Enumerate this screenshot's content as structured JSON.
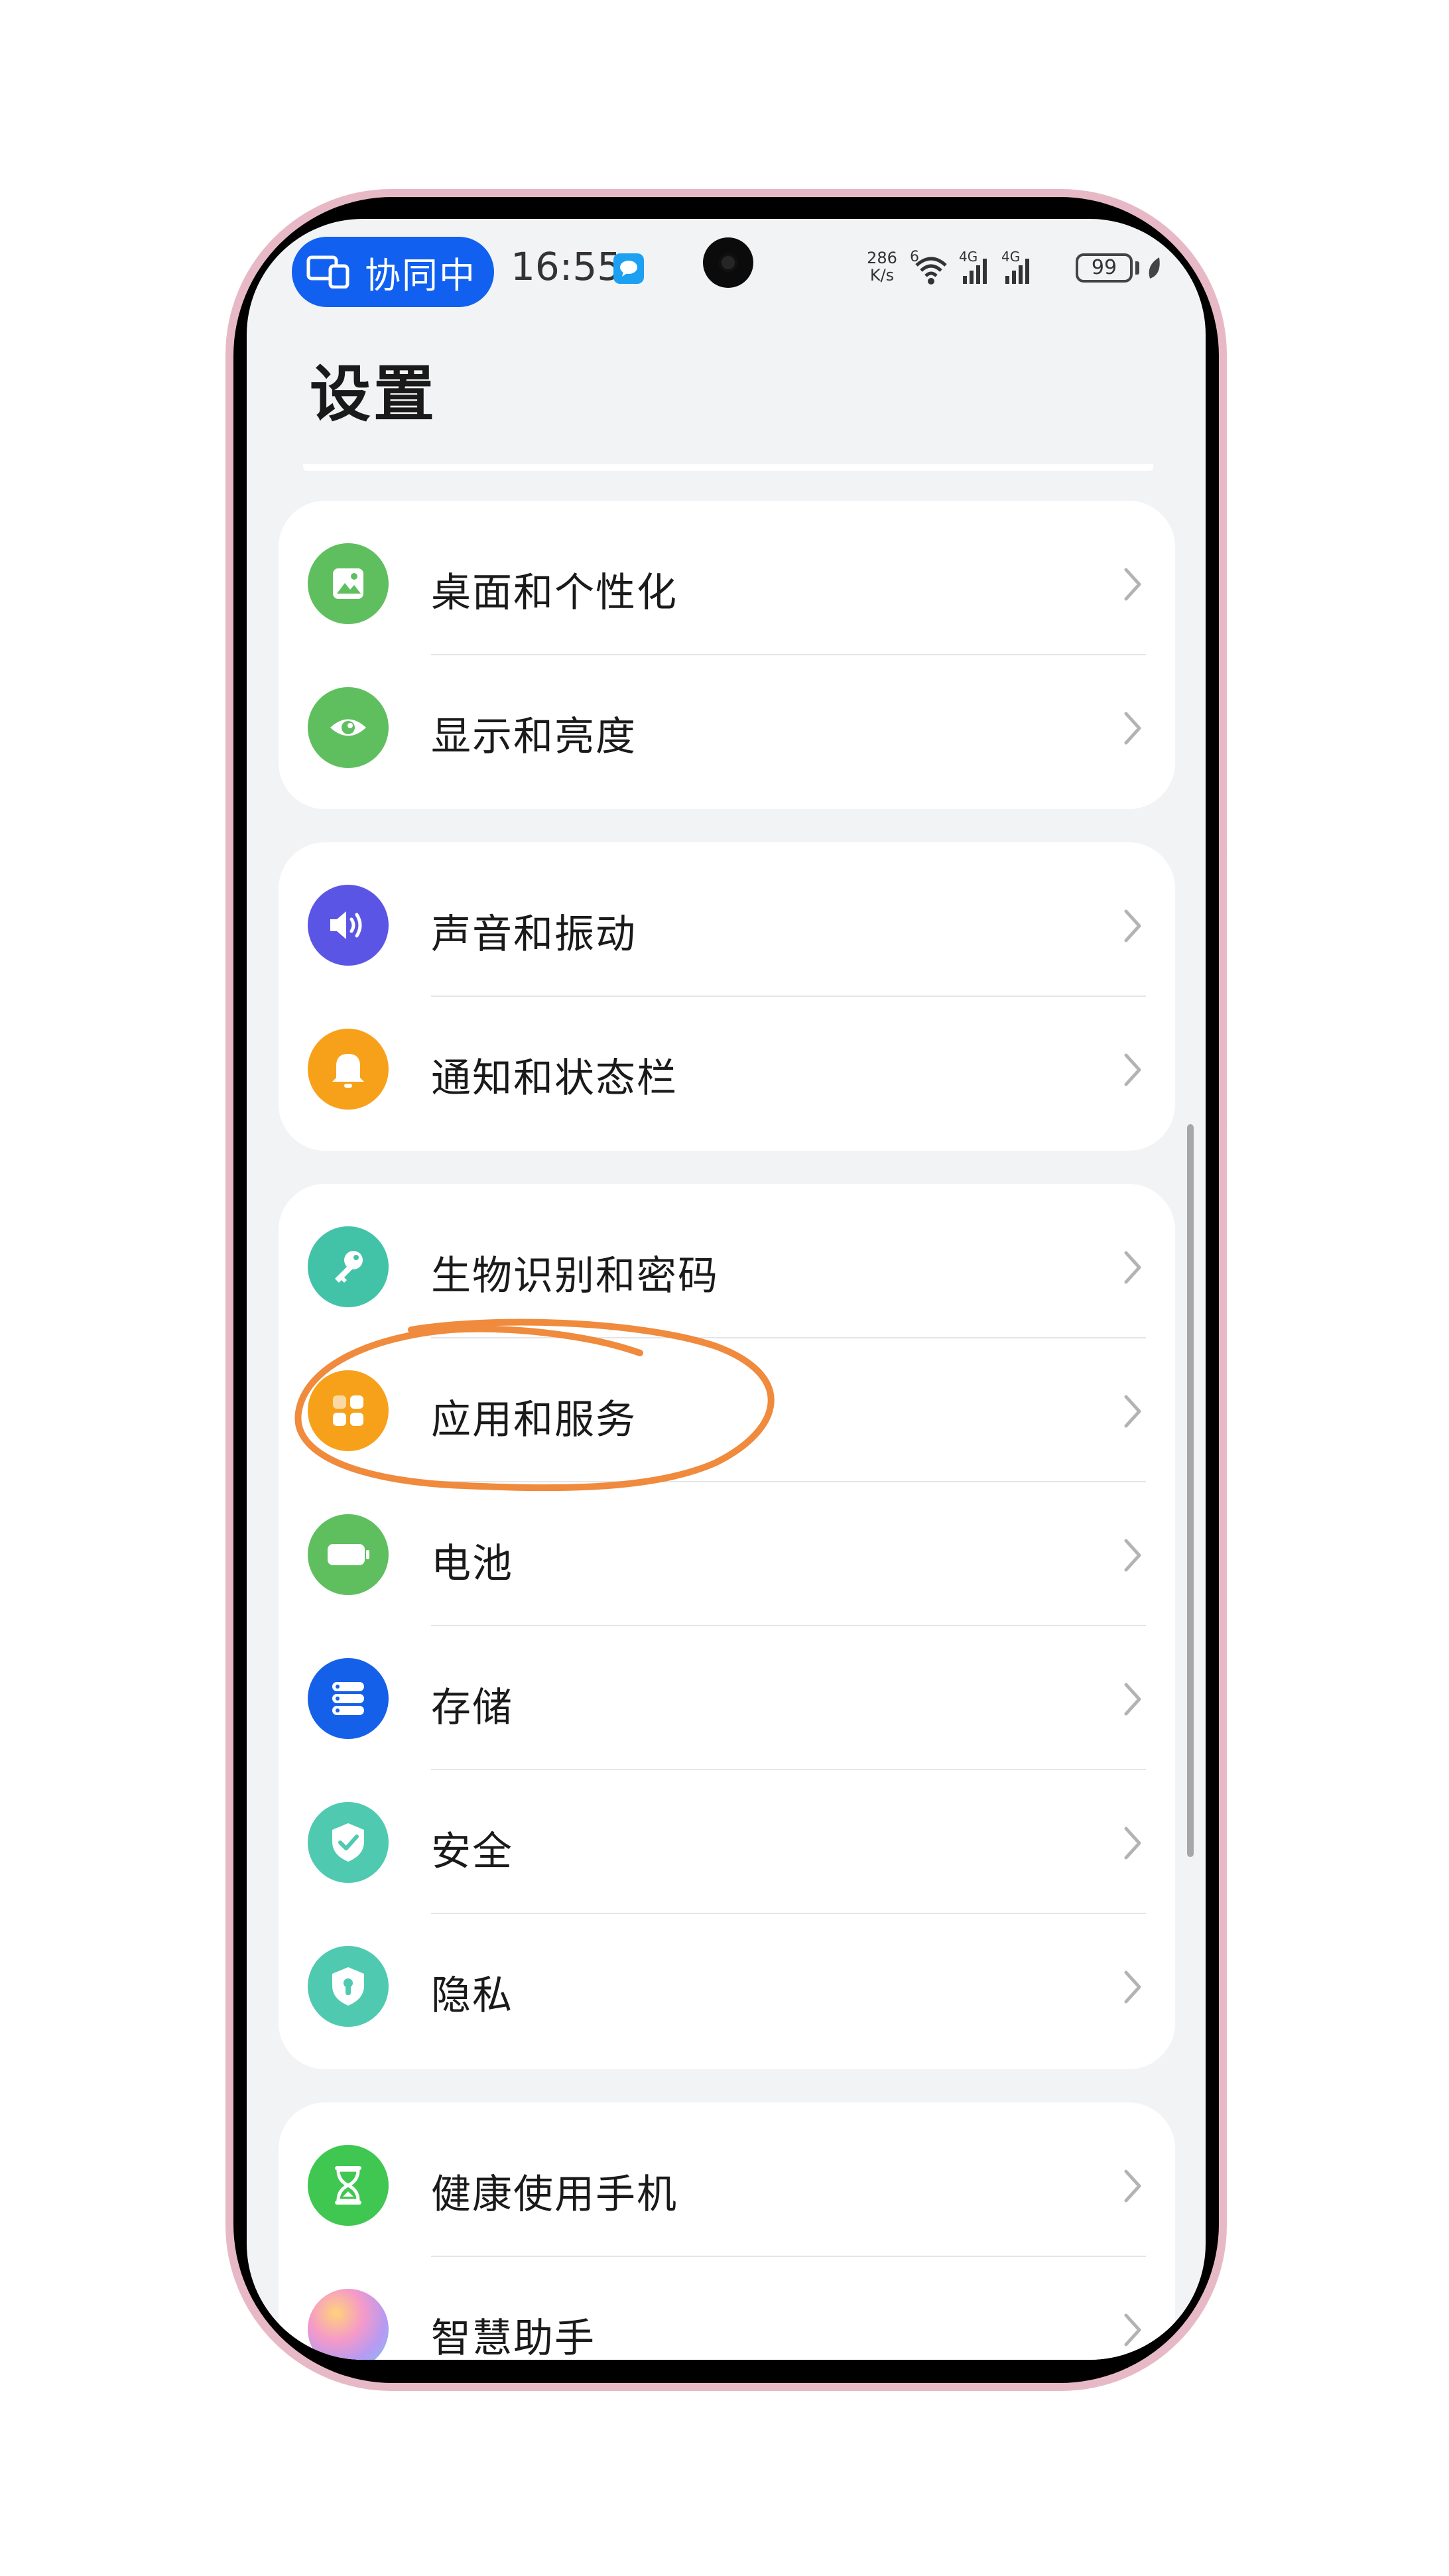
{
  "status_bar": {
    "collab_label": "协同中",
    "time": "16:55",
    "net_speed_value": "286",
    "net_speed_unit": "K/s",
    "wifi_badge": "6",
    "signal1_label": "4G",
    "signal2_label": "4G",
    "battery_level": "99"
  },
  "page": {
    "title": "设置"
  },
  "groups": [
    {
      "items": [
        {
          "label": "桌面和个性化",
          "icon": "wallpaper-icon",
          "color": "#5fbf5f"
        },
        {
          "label": "显示和亮度",
          "icon": "eye-icon",
          "color": "#5fbf5f"
        }
      ]
    },
    {
      "items": [
        {
          "label": "声音和振动",
          "icon": "speaker-icon",
          "color": "#5b55e6"
        },
        {
          "label": "通知和状态栏",
          "icon": "bell-icon",
          "color": "#f7a11b"
        }
      ]
    },
    {
      "items": [
        {
          "label": "生物识别和密码",
          "icon": "key-icon",
          "color": "#42c3a7"
        },
        {
          "label": "应用和服务",
          "icon": "apps-grid-icon",
          "color": "#f7a11b"
        },
        {
          "label": "电池",
          "icon": "battery-icon",
          "color": "#5fbf5f"
        },
        {
          "label": "存储",
          "icon": "storage-icon",
          "color": "#1560e8"
        },
        {
          "label": "安全",
          "icon": "shield-check-icon",
          "color": "#4fcab0"
        },
        {
          "label": "隐私",
          "icon": "privacy-shield-icon",
          "color": "#4fcab0"
        }
      ]
    },
    {
      "items": [
        {
          "label": "健康使用手机",
          "icon": "hourglass-icon",
          "color": "#3fc751"
        },
        {
          "label": "智慧助手",
          "icon": "assistant-orb-icon",
          "color": "#c8a6ef"
        }
      ]
    }
  ],
  "colors": {
    "annotation_stroke": "#f08a3c",
    "screen_background": "#f2f3f5",
    "phone_frame": "#e7b9c6",
    "collab_pill": "#1160f0"
  }
}
